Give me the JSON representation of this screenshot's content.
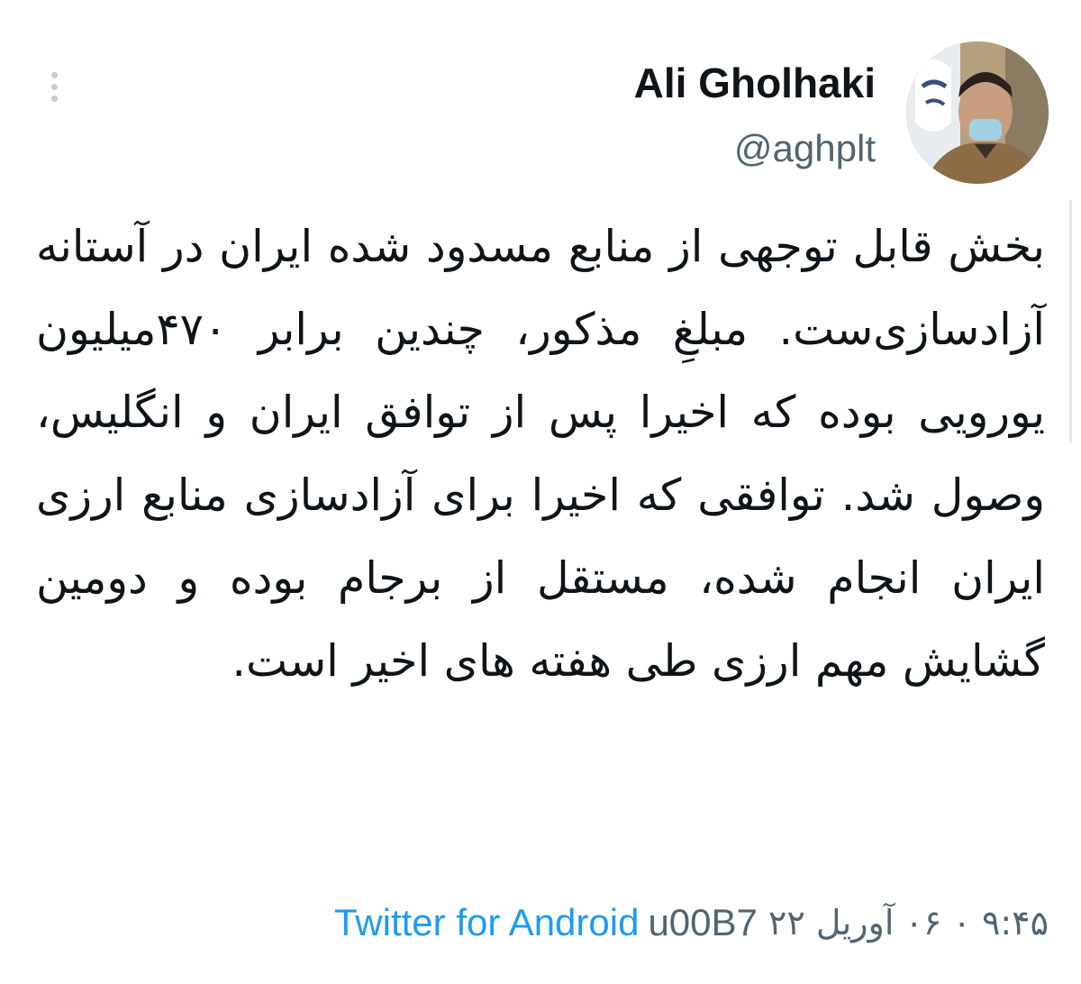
{
  "tweet": {
    "author": {
      "display_name": "Ali Gholhaki",
      "handle": "@aghplt"
    },
    "text": "بخش قابل توجهی از منابع مسدود شده ایران در آستانه آزادسازی‌ست. مبلغِ مذکور، چندین برابر ۴۷۰میلیون یورویی بوده که اخیرا پس از توافق ایران و انگلیس، وصول شد. توافقی که اخیرا برای آزادسازی منابع ارزی ایران انجام شده، مستقل از برجام بوده و دومین گشایش مهم ارزی طی هفته های اخیر است.",
    "timestamp": "۹:۴۵ ۰ ۰۶ آوریل ۲۲",
    "separator": "u00B7",
    "source": "Twitter for Android"
  },
  "icons": {
    "more": "more-vertical-icon",
    "avatar": "profile-photo"
  },
  "colors": {
    "link": "#1d9bf0",
    "secondary_text": "#536471",
    "primary_text": "#0f1419"
  }
}
